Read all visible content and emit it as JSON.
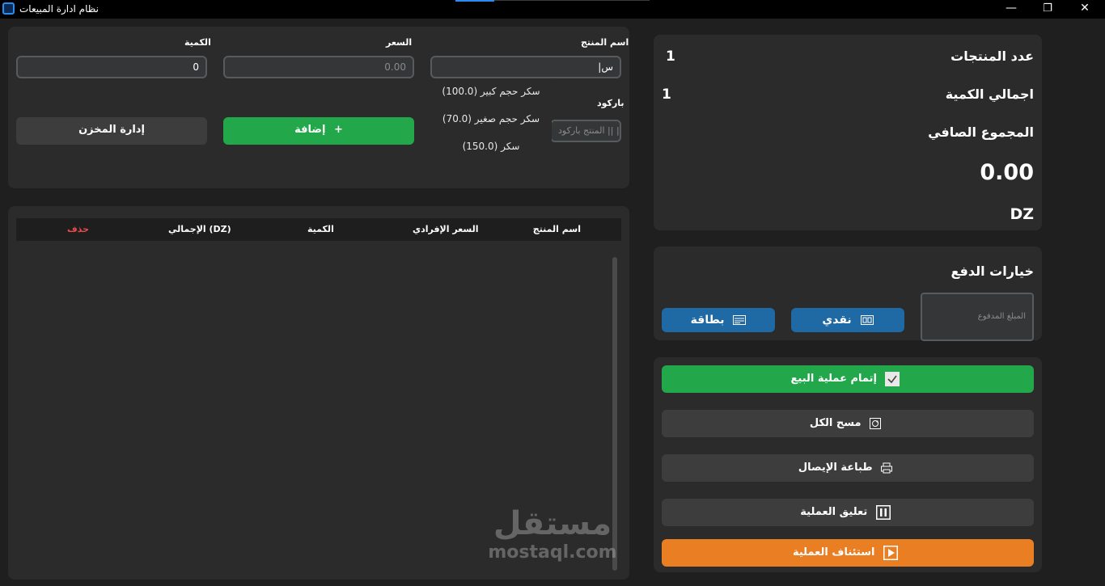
{
  "window": {
    "title": "نظام ادارة المبيعات",
    "minimize": "—",
    "maximize": "❐",
    "close": "✕"
  },
  "entry": {
    "product_name_label": "اسم المنتج",
    "product_name_value": "|س",
    "price_label": "السعر",
    "price_placeholder": "0.00",
    "quantity_label": "الكمية",
    "quantity_value": "0",
    "barcode_label": "باركود",
    "barcode_placeholder": "المنتج باركود || ||",
    "add_button": "إضافة",
    "add_icon": "+",
    "inventory_button": "إدارة المخزن"
  },
  "suggestions": [
    "سكر حجم كبير (100.0)",
    "سكر حجم صغير (70.0)",
    "سكر (150.0)"
  ],
  "table": {
    "columns": [
      "اسم المنتج",
      "السعر الإفرادي",
      "الكمية",
      "الإجمالي (DZ)",
      "حذف"
    ],
    "delete_color": "#e84a4a",
    "rows": []
  },
  "summary": {
    "product_count_label": "عدد المنتجات",
    "product_count_value": "1",
    "total_quantity_label": "اجمالي الكمية",
    "total_quantity_value": "1",
    "net_total_label": "المجموع الصافي",
    "net_total_value": "0.00",
    "currency": "DZ"
  },
  "payment": {
    "title": "خيارات الدفع",
    "paid_amount_placeholder": "المبلغ المدفوع",
    "cash_button": "نقدي",
    "card_button": "بطاقة",
    "button_color": "#1f6aa5"
  },
  "actions": {
    "complete_sale": "إتمام عملية البيع",
    "clear_all": "مسح الكل",
    "print_receipt": "طباعة الإيصال",
    "suspend": "تعليق العملية",
    "resume": "استئناف العملية",
    "complete_color": "#22a84a",
    "resume_color": "#ea7e22"
  },
  "watermark": {
    "arabic": "مستقل",
    "latin": "mostaql.com"
  }
}
